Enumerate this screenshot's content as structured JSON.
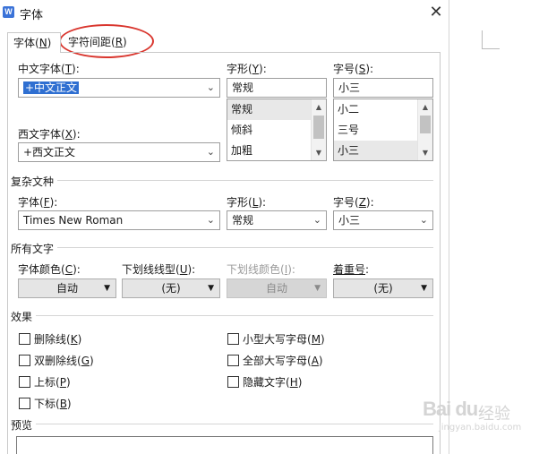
{
  "dialog": {
    "app_icon": "W",
    "title": "字体",
    "close_glyph": "✕"
  },
  "tabs": [
    {
      "label": "字体(",
      "key": "N",
      "tail": ")"
    },
    {
      "label": "字符间距(",
      "key": "R",
      "tail": ")"
    }
  ],
  "chinese_font": {
    "label_pre": "中文字体(",
    "key": "T",
    "label_post": "):",
    "value": "+中文正文"
  },
  "style": {
    "label_pre": "字形(",
    "key": "Y",
    "label_post": "):",
    "value": "常规",
    "options": [
      "常规",
      "倾斜",
      "加粗"
    ],
    "selected_index": 0
  },
  "size": {
    "label_pre": "字号(",
    "key": "S",
    "label_post": "):",
    "value": "小三",
    "options": [
      "小二",
      "三号",
      "小三"
    ],
    "selected_index": 2
  },
  "western_font": {
    "label_pre": "西文字体(",
    "key": "X",
    "label_post": "):",
    "value": "+西文正文"
  },
  "complex": {
    "section": "复杂文种",
    "font": {
      "label_pre": "字体(",
      "key": "F",
      "label_post": "):",
      "value": "Times New Roman"
    },
    "style": {
      "label_pre": "字形(",
      "key": "L",
      "label_post": "):",
      "value": "常规"
    },
    "size": {
      "label_pre": "字号(",
      "key": "Z",
      "label_post": "):",
      "value": "小三"
    }
  },
  "all_text": {
    "section": "所有文字",
    "font_color": {
      "label_pre": "字体颜色(",
      "key": "C",
      "label_post": "):",
      "value": "自动"
    },
    "underline_type": {
      "label_pre": "下划线线型(",
      "key": "U",
      "label_post": "):",
      "value": "(无)"
    },
    "underline_color": {
      "label_pre": "下划线颜色(",
      "key": "I",
      "label_post": "):",
      "value": "自动"
    },
    "emphasis": {
      "label_pre": "着重号",
      "key": "",
      "label_post": ":",
      "value": "(无)"
    }
  },
  "effects": {
    "section": "效果",
    "left": [
      {
        "label": "删除线(",
        "key": "K",
        "tail": ")"
      },
      {
        "label": "双删除线(",
        "key": "G",
        "tail": ")"
      },
      {
        "label": "上标(",
        "key": "P",
        "tail": ")"
      },
      {
        "label": "下标(",
        "key": "B",
        "tail": ")"
      }
    ],
    "right": [
      {
        "label": "小型大写字母(",
        "key": "M",
        "tail": ")"
      },
      {
        "label": "全部大写字母(",
        "key": "A",
        "tail": ")"
      },
      {
        "label": "隐藏文字(",
        "key": "H",
        "tail": ")"
      }
    ]
  },
  "preview": {
    "section": "预览"
  },
  "watermark": {
    "logo": "Bai du",
    "sub": "经验",
    "url": "jingyan.baidu.com"
  },
  "colors": {
    "highlight_circle": "#d9362e",
    "selection": "#2f6fd1",
    "app_icon": "#3b73d8"
  }
}
